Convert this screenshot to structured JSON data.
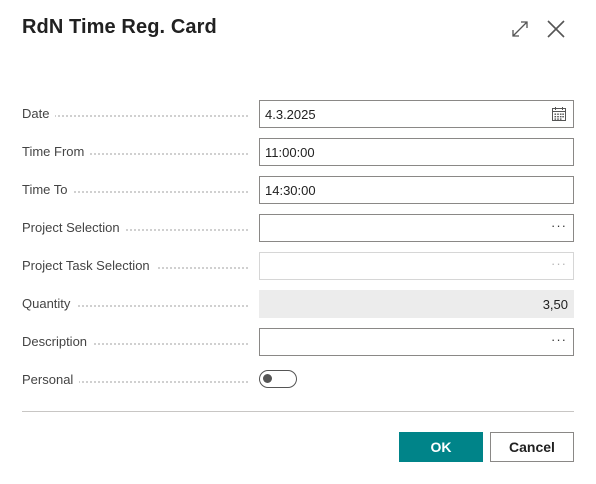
{
  "dialog": {
    "title": "RdN Time Reg. Card",
    "expand_icon": "expand-icon",
    "close_icon": "close-icon"
  },
  "fields": {
    "date": {
      "label": "Date",
      "value": "4.3.2025",
      "icon": "calendar-icon"
    },
    "time_from": {
      "label": "Time From",
      "value": "11:00:00"
    },
    "time_to": {
      "label": "Time To",
      "value": "14:30:00"
    },
    "project_selection": {
      "label": "Project Selection",
      "value": "",
      "button": "···"
    },
    "project_task_selection": {
      "label": "Project Task Selection",
      "value": "",
      "button": "···"
    },
    "quantity": {
      "label": "Quantity",
      "value": "3,50"
    },
    "description": {
      "label": "Description",
      "value": "",
      "button": "···"
    },
    "personal": {
      "label": "Personal",
      "checked": false
    }
  },
  "footer": {
    "ok_label": "OK",
    "cancel_label": "Cancel"
  },
  "colors": {
    "accent": "#008489",
    "border": "#8a8886",
    "readonly_bg": "#ececec"
  }
}
